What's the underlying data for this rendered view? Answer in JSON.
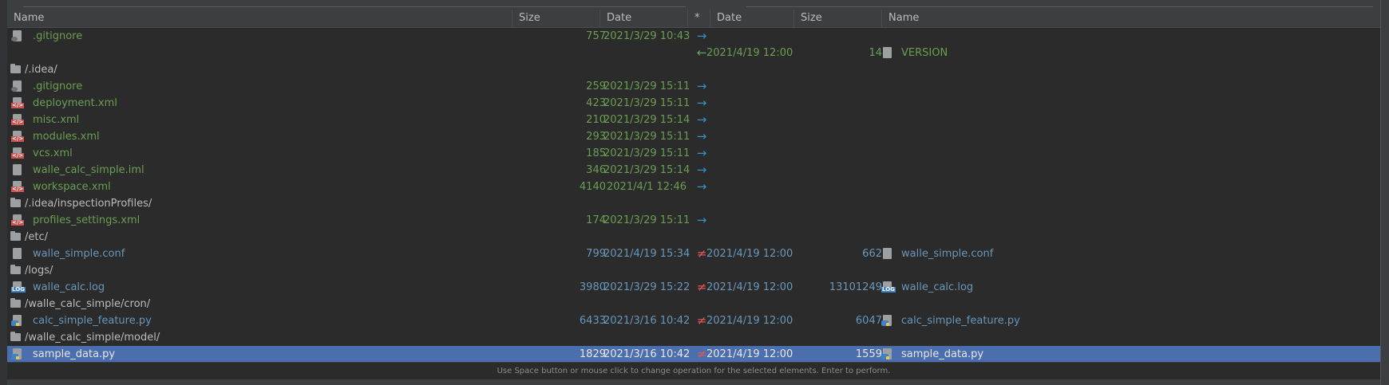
{
  "colors": {
    "green": "#6a9e52",
    "blue": "#6897bb",
    "text": "#bbbbbb",
    "selected_bg": "#4b6eaf",
    "arrow_right": "#3592c4",
    "arrow_left": "#59a869",
    "not_equal": "#e05555"
  },
  "header": {
    "name": "Name",
    "size": "Size",
    "date": "Date",
    "op": "*",
    "rdate": "Date",
    "rsize": "Size",
    "rname": "Name"
  },
  "rows": [
    {
      "kind": "file",
      "color": "green",
      "lname": ".gitignore",
      "lsize": "757",
      "ldate": "2021/3/29 10:43",
      "op": "→",
      "opcolor": "arrow_right",
      "licon": "gear",
      "rdate": "",
      "rsize": "",
      "rname": "",
      "ricon": ""
    },
    {
      "kind": "file",
      "color": "green",
      "lname": "",
      "lsize": "",
      "ldate": "",
      "op": "←",
      "opcolor": "arrow_left",
      "licon": "",
      "rdate": "2021/4/19 12:00",
      "rsize": "14",
      "rname": "VERSION",
      "ricon": "text"
    },
    {
      "kind": "dir",
      "name": "/.idea/"
    },
    {
      "kind": "file",
      "color": "green",
      "lname": ".gitignore",
      "lsize": "259",
      "ldate": "2021/3/29 15:11",
      "op": "→",
      "opcolor": "arrow_right",
      "licon": "gear",
      "rdate": "",
      "rsize": "",
      "rname": "",
      "ricon": ""
    },
    {
      "kind": "file",
      "color": "green",
      "lname": "deployment.xml",
      "lsize": "423",
      "ldate": "2021/3/29 15:11",
      "op": "→",
      "opcolor": "arrow_right",
      "licon": "xml",
      "rdate": "",
      "rsize": "",
      "rname": "",
      "ricon": ""
    },
    {
      "kind": "file",
      "color": "green",
      "lname": "misc.xml",
      "lsize": "210",
      "ldate": "2021/3/29 15:14",
      "op": "→",
      "opcolor": "arrow_right",
      "licon": "xml",
      "rdate": "",
      "rsize": "",
      "rname": "",
      "ricon": ""
    },
    {
      "kind": "file",
      "color": "green",
      "lname": "modules.xml",
      "lsize": "293",
      "ldate": "2021/3/29 15:11",
      "op": "→",
      "opcolor": "arrow_right",
      "licon": "xml",
      "rdate": "",
      "rsize": "",
      "rname": "",
      "ricon": ""
    },
    {
      "kind": "file",
      "color": "green",
      "lname": "vcs.xml",
      "lsize": "185",
      "ldate": "2021/3/29 15:11",
      "op": "→",
      "opcolor": "arrow_right",
      "licon": "xml",
      "rdate": "",
      "rsize": "",
      "rname": "",
      "ricon": ""
    },
    {
      "kind": "file",
      "color": "green",
      "lname": "walle_calc_simple.iml",
      "lsize": "346",
      "ldate": "2021/3/29 15:14",
      "op": "→",
      "opcolor": "arrow_right",
      "licon": "iml",
      "rdate": "",
      "rsize": "",
      "rname": "",
      "ricon": ""
    },
    {
      "kind": "file",
      "color": "green",
      "lname": "workspace.xml",
      "lsize": "4140",
      "ldate": "2021/4/1 12:46",
      "op": "→",
      "opcolor": "arrow_right",
      "licon": "xml",
      "rdate": "",
      "rsize": "",
      "rname": "",
      "ricon": ""
    },
    {
      "kind": "dir",
      "name": "/.idea/inspectionProfiles/"
    },
    {
      "kind": "file",
      "color": "green",
      "lname": "profiles_settings.xml",
      "lsize": "174",
      "ldate": "2021/3/29 15:11",
      "op": "→",
      "opcolor": "arrow_right",
      "licon": "xml",
      "rdate": "",
      "rsize": "",
      "rname": "",
      "ricon": ""
    },
    {
      "kind": "dir",
      "name": "/etc/"
    },
    {
      "kind": "file",
      "color": "blue",
      "lname": "walle_simple.conf",
      "lsize": "799",
      "ldate": "2021/4/19 15:34",
      "op": "≠",
      "opcolor": "not_equal",
      "licon": "text",
      "rdate": "2021/4/19 12:00",
      "rsize": "662",
      "rname": "walle_simple.conf",
      "ricon": "text"
    },
    {
      "kind": "dir",
      "name": "/logs/"
    },
    {
      "kind": "file",
      "color": "blue",
      "lname": "walle_calc.log",
      "lsize": "3980",
      "ldate": "2021/3/29 15:22",
      "op": "≠",
      "opcolor": "not_equal",
      "licon": "log",
      "rdate": "2021/4/19 12:00",
      "rsize": "13101249",
      "rname": "walle_calc.log",
      "ricon": "log"
    },
    {
      "kind": "dir",
      "name": "/walle_calc_simple/cron/"
    },
    {
      "kind": "file",
      "color": "blue",
      "lname": "calc_simple_feature.py",
      "lsize": "6433",
      "ldate": "2021/3/16 10:42",
      "op": "≠",
      "opcolor": "not_equal",
      "licon": "py",
      "rdate": "2021/4/19 12:00",
      "rsize": "6047",
      "rname": "calc_simple_feature.py",
      "ricon": "py"
    },
    {
      "kind": "dir",
      "name": "/walle_calc_simple/model/"
    },
    {
      "kind": "file",
      "color": "text",
      "selected": true,
      "lname": "sample_data.py",
      "lsize": "1829",
      "ldate": "2021/3/16 10:42",
      "op": "≠",
      "opcolor": "not_equal",
      "licon": "py",
      "rdate": "2021/4/19 12:00",
      "rsize": "1559",
      "rname": "sample_data.py",
      "ricon": "py"
    }
  ],
  "footer": "Use Space button or mouse click to change operation for the selected elements. Enter to perform."
}
